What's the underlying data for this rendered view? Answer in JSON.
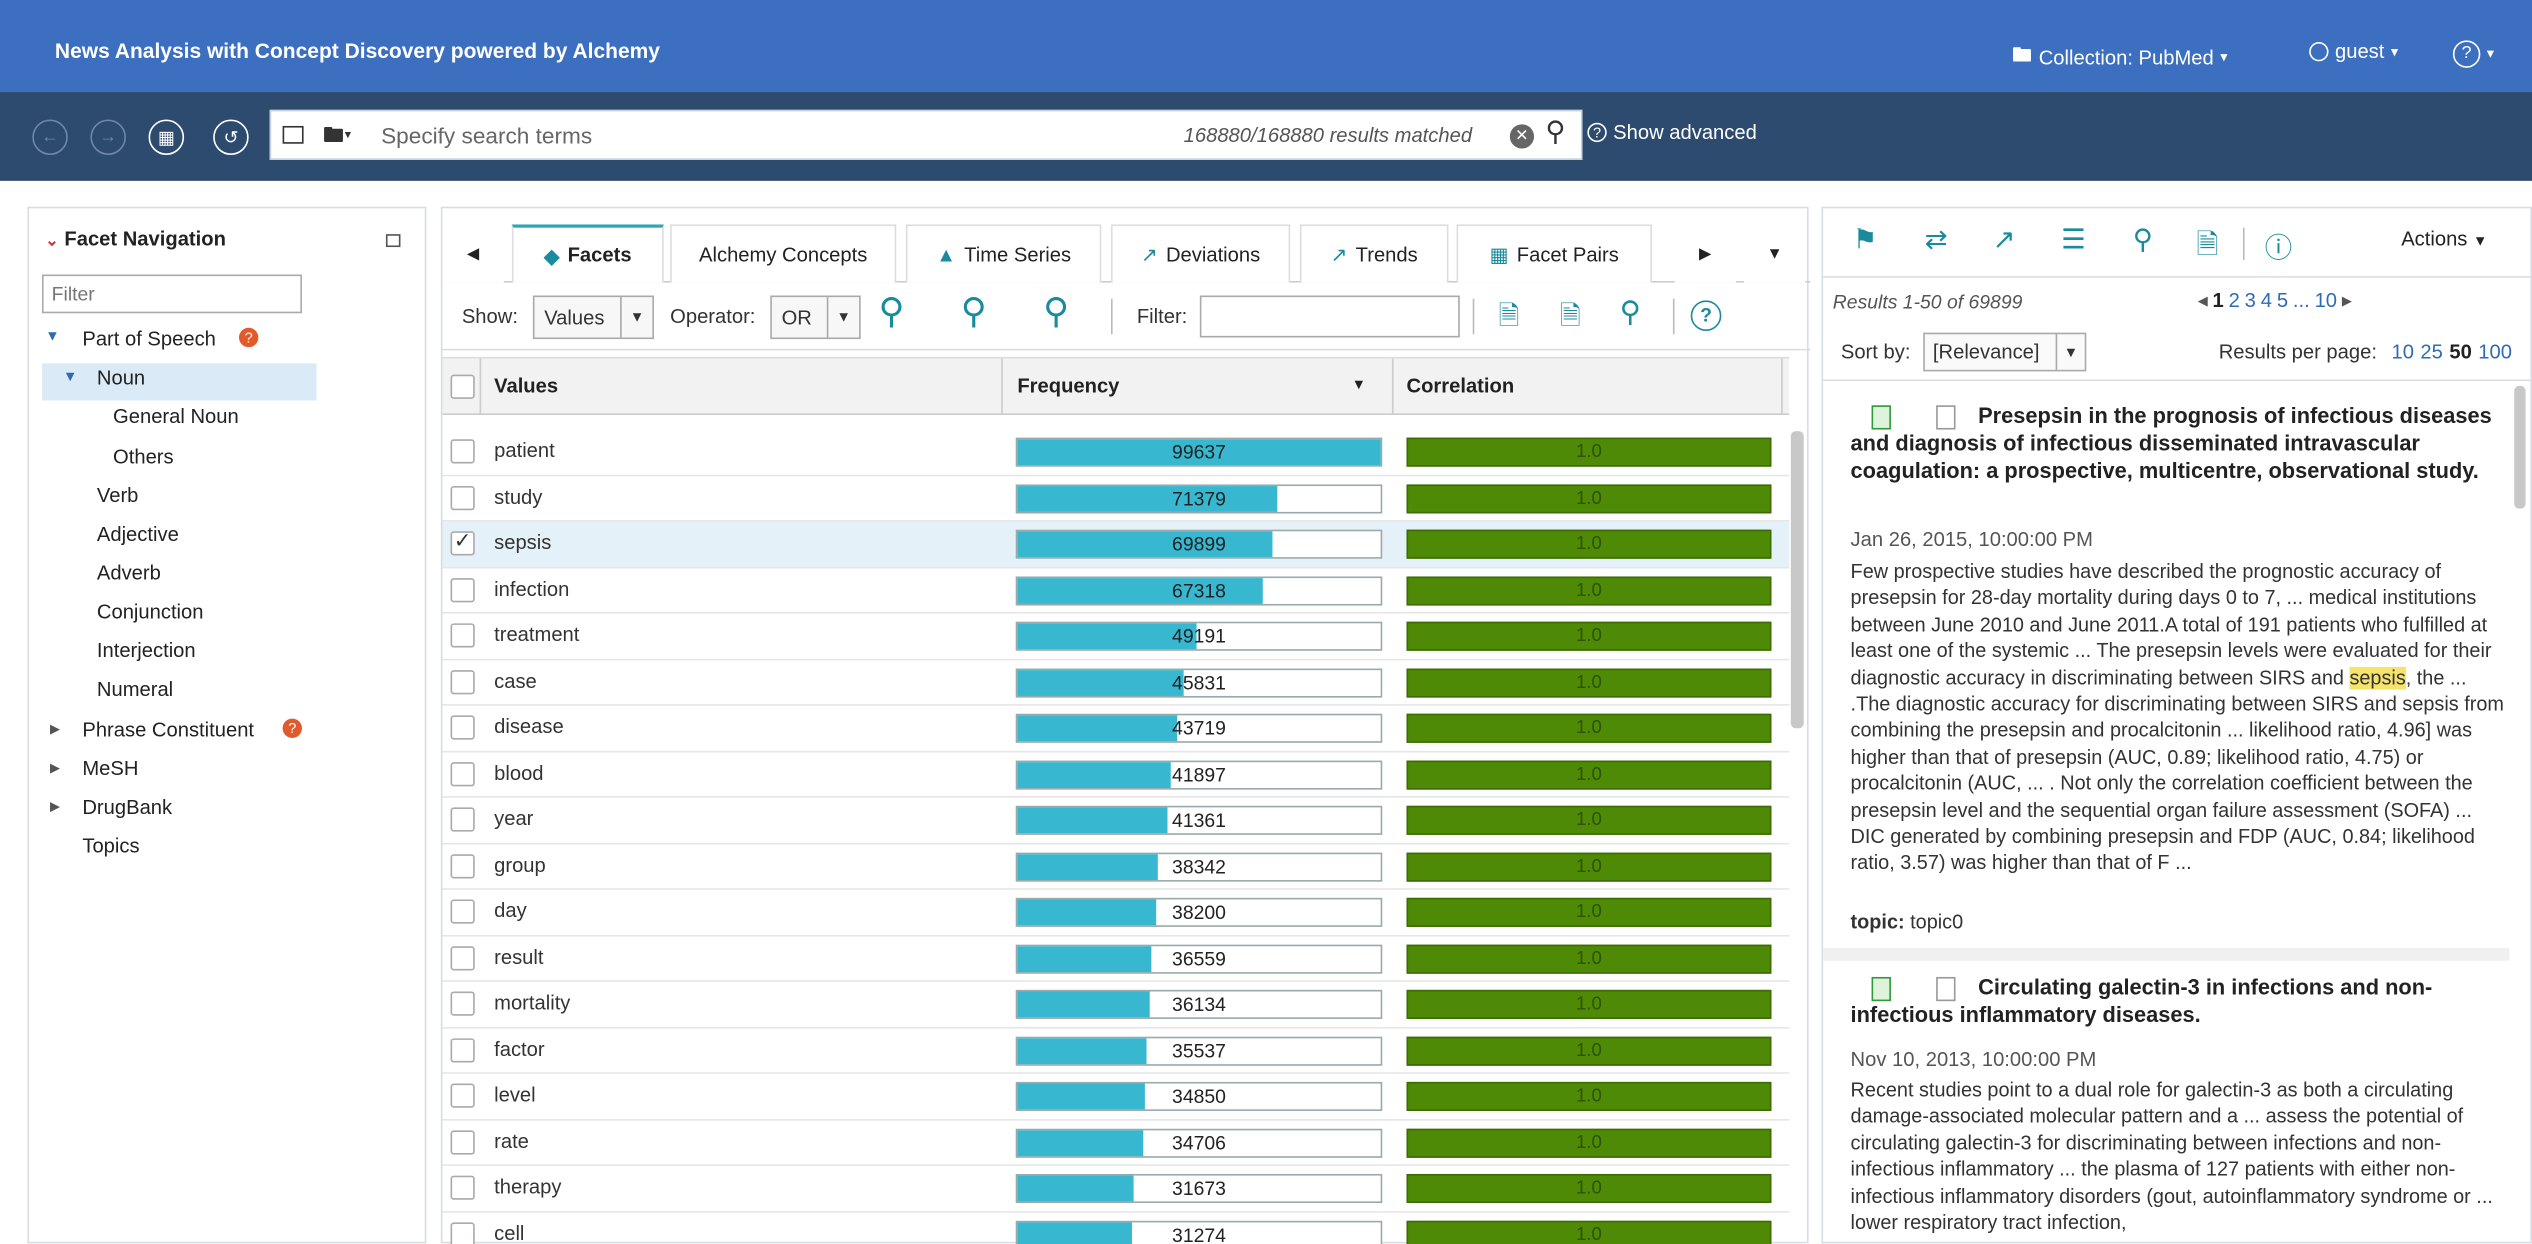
{
  "app": {
    "title": "News Analysis with Concept Discovery powered by Alchemy",
    "collection": "Collection: PubMed",
    "user": "guest",
    "help": "?"
  },
  "search": {
    "placeholder": "Specify search terms",
    "results_matched": "168880/168880 results matched",
    "show_advanced": "Show advanced"
  },
  "facet_nav": {
    "header": "Facet Navigation",
    "filter_placeholder": "Filter",
    "items": {
      "pos": "Part of Speech",
      "noun": "Noun",
      "general_noun": "General Noun",
      "others": "Others",
      "verb": "Verb",
      "adjective": "Adjective",
      "adverb": "Adverb",
      "conjunction": "Conjunction",
      "interjection": "Interjection",
      "numeral": "Numeral",
      "phrase": "Phrase Constituent",
      "mesh": "MeSH",
      "drugbank": "DrugBank",
      "topics": "Topics"
    }
  },
  "tabs": {
    "facets": "Facets",
    "alchemy": "Alchemy Concepts",
    "time_series": "Time Series",
    "deviations": "Deviations",
    "trends": "Trends",
    "facet_pairs": "Facet Pairs"
  },
  "options": {
    "show_label": "Show:",
    "show_value": "Values",
    "operator_label": "Operator:",
    "operator_value": "OR",
    "filter_label": "Filter:"
  },
  "grid": {
    "col_values": "Values",
    "col_frequency": "Frequency",
    "col_correlation": "Correlation",
    "max": 99637,
    "rows": [
      {
        "value": "patient",
        "freq": 99637,
        "corr": "1.0",
        "checked": false
      },
      {
        "value": "study",
        "freq": 71379,
        "corr": "1.0",
        "checked": false
      },
      {
        "value": "sepsis",
        "freq": 69899,
        "corr": "1.0",
        "checked": true
      },
      {
        "value": "infection",
        "freq": 67318,
        "corr": "1.0",
        "checked": false
      },
      {
        "value": "treatment",
        "freq": 49191,
        "corr": "1.0",
        "checked": false
      },
      {
        "value": "case",
        "freq": 45831,
        "corr": "1.0",
        "checked": false
      },
      {
        "value": "disease",
        "freq": 43719,
        "corr": "1.0",
        "checked": false
      },
      {
        "value": "blood",
        "freq": 41897,
        "corr": "1.0",
        "checked": false
      },
      {
        "value": "year",
        "freq": 41361,
        "corr": "1.0",
        "checked": false
      },
      {
        "value": "group",
        "freq": 38342,
        "corr": "1.0",
        "checked": false
      },
      {
        "value": "day",
        "freq": 38200,
        "corr": "1.0",
        "checked": false
      },
      {
        "value": "result",
        "freq": 36559,
        "corr": "1.0",
        "checked": false
      },
      {
        "value": "mortality",
        "freq": 36134,
        "corr": "1.0",
        "checked": false
      },
      {
        "value": "factor",
        "freq": 35537,
        "corr": "1.0",
        "checked": false
      },
      {
        "value": "level",
        "freq": 34850,
        "corr": "1.0",
        "checked": false
      },
      {
        "value": "rate",
        "freq": 34706,
        "corr": "1.0",
        "checked": false
      },
      {
        "value": "therapy",
        "freq": 31673,
        "corr": "1.0",
        "checked": false
      },
      {
        "value": "cell",
        "freq": 31274,
        "corr": "1.0",
        "checked": false
      }
    ]
  },
  "results": {
    "actions": "Actions",
    "summary": "Results 1-50 of 69899",
    "pages": [
      "1",
      "2",
      "3",
      "4",
      "5",
      "...",
      "10"
    ],
    "sort_label": "Sort by:",
    "sort_value": "[Relevance]",
    "per_page_label": "Results per page:",
    "per_page": [
      "10",
      "25",
      "50",
      "100"
    ],
    "docs": [
      {
        "title": "Presepsin in the prognosis of infectious diseases and diagnosis of infectious disseminated intravascular coagulation: a prospective, multicentre, observational study.",
        "date": "Jan 26, 2015, 10:00:00 PM",
        "body_before": "Few prospective studies have described the prognostic accuracy of presepsin for 28-day mortality during days 0 to 7, ... medical institutions between June 2010 and June 2011.A total of 191 patients who fulfilled at least one of the systemic ... The presepsin levels were evaluated for their diagnostic accuracy in discriminating between SIRS and ",
        "highlight": "sepsis",
        "body_after": ", the ... .The diagnostic accuracy for discriminating between SIRS and sepsis from combining the presepsin and procalcitonin ... likelihood ratio, 4.96] was higher than that of presepsin (AUC, 0.89; likelihood ratio, 4.75) or procalcitonin (AUC, ... . Not only the correlation coefficient between the presepsin level and the sequential organ failure assessment (SOFA) ... DIC generated by combining presepsin and FDP (AUC, 0.84; likelihood ratio, 3.57) was higher than that of F ...",
        "topic_label": "topic:",
        "topic_value": "topic0"
      },
      {
        "title": "Circulating galectin-3 in infections and non-infectious inflammatory diseases.",
        "date": "Nov 10, 2013, 10:00:00 PM",
        "body": "Recent studies point to a dual role for galectin-3 as both a circulating damage-associated molecular pattern and a ... assess the potential of circulating galectin-3 for discriminating between infections and non-infectious inflammatory ... the plasma of 127 patients with either non-infectious inflammatory disorders (gout, autoinflammatory syndrome or ... lower respiratory tract infection,"
      }
    ]
  },
  "colors": {
    "header": "#3c6fbf",
    "toolbar": "#2d4a6f",
    "freq_bar": "#38b8d0",
    "corr_bar": "#4e8a05",
    "accent": "#1a8b9c"
  }
}
